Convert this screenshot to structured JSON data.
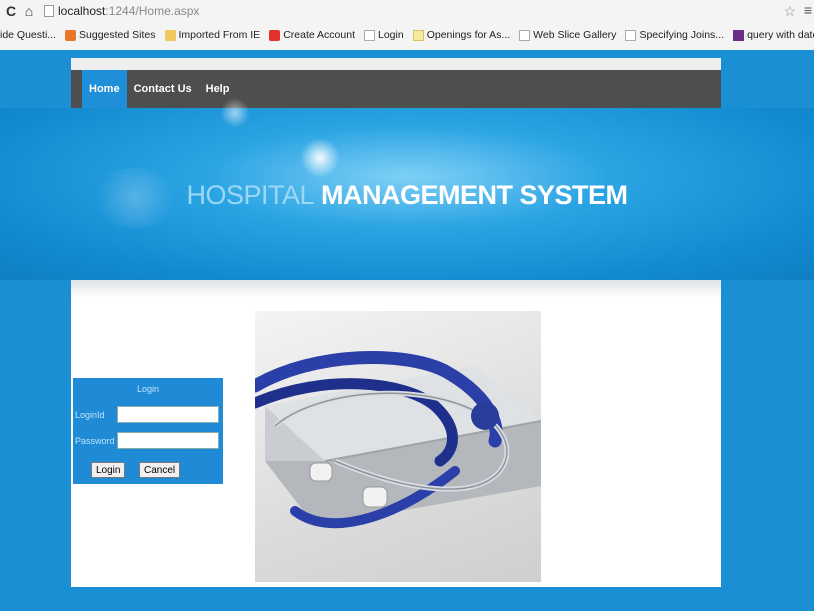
{
  "browser": {
    "url_host": "localhost",
    "url_path": ":1244/Home.aspx",
    "bookmarks": [
      {
        "label": "ide Questi...",
        "icon": "none"
      },
      {
        "label": "Suggested Sites",
        "icon": "orange"
      },
      {
        "label": "Imported From IE",
        "icon": "folder"
      },
      {
        "label": "Create Account",
        "icon": "red"
      },
      {
        "label": "Login",
        "icon": "page"
      },
      {
        "label": "Openings for As...",
        "icon": "yellow"
      },
      {
        "label": "Web Slice Gallery",
        "icon": "page"
      },
      {
        "label": "Specifying Joins...",
        "icon": "page"
      },
      {
        "label": "query with date...",
        "icon": "purple"
      }
    ]
  },
  "nav": {
    "home": "Home",
    "contact": "Contact Us",
    "help": "Help"
  },
  "banner": {
    "title_part1": "HOSPITAL",
    "title_part2": "MANAGEMENT SYSTEM"
  },
  "login": {
    "title": "Login",
    "loginid_label": "LoginId",
    "loginid_value": "",
    "password_label": "Password",
    "password_value": "",
    "login_button": "Login",
    "cancel_button": "Cancel"
  },
  "image": {
    "subject": "stethoscope-on-laptop"
  }
}
